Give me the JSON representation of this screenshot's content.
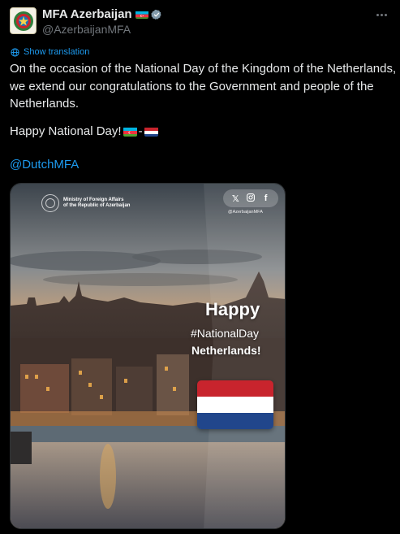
{
  "post": {
    "author": {
      "display_name": "MFA Azerbaijan",
      "handle": "@AzerbaijanMFA",
      "verified_icon": "gray-verified-badge-icon",
      "name_flag": "azerbaijan-flag-emoji"
    },
    "more_icon": "more-horizontal-icon",
    "show_translation_label": "Show translation",
    "text_lines": [
      "On the occasion of the National Day of the Kingdom of the Netherlands,",
      "we extend our congratulations to the Government and people of the",
      "Netherlands."
    ],
    "greeting": "Happy National Day!",
    "greeting_separator": "-",
    "mention": "@DutchMFA"
  },
  "media": {
    "ministry_line1": "Ministry of Foreign Affairs",
    "ministry_line2": "of the Republic of Azerbaijan",
    "social_icons": [
      "x-logo-icon",
      "instagram-icon",
      "facebook-icon"
    ],
    "social_handle": "@AzerbaijanMFA",
    "overlay_happy": "Happy",
    "overlay_hashtag": "#NationalDay",
    "overlay_country": "Netherlands!",
    "flag_colors": [
      "#c8242d",
      "#ffffff",
      "#21468b"
    ]
  },
  "colors": {
    "link": "#1d9bf0",
    "text": "#e7e9ea",
    "muted": "#71767b",
    "background": "#000000"
  }
}
